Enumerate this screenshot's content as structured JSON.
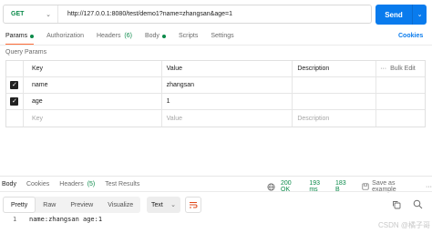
{
  "request": {
    "method": "GET",
    "url": "http://127.0.0.1:8080/test/demo1?name=zhangsan&age=1",
    "send_label": "Send"
  },
  "request_tabs": [
    {
      "label": "Params",
      "active": true,
      "dot": true
    },
    {
      "label": "Authorization"
    },
    {
      "label": "Headers",
      "count": "(6)"
    },
    {
      "label": "Body",
      "dot": true
    },
    {
      "label": "Scripts"
    },
    {
      "label": "Settings"
    }
  ],
  "cookies_label": "Cookies",
  "query_params": {
    "title": "Query Params",
    "headers": {
      "key": "Key",
      "value": "Value",
      "description": "Description",
      "bulk_edit": "Bulk Edit"
    },
    "rows": [
      {
        "checked": true,
        "key": "name",
        "value": "zhangsan",
        "description": ""
      },
      {
        "checked": true,
        "key": "age",
        "value": "1",
        "description": ""
      }
    ],
    "placeholder": {
      "key": "Key",
      "value": "Value",
      "description": "Description"
    }
  },
  "response_tabs": [
    {
      "label": "Body",
      "active": true
    },
    {
      "label": "Cookies"
    },
    {
      "label": "Headers",
      "count": "(5)"
    },
    {
      "label": "Test Results"
    }
  ],
  "response_status": {
    "status": "200 OK",
    "time": "193 ms",
    "size": "183 B",
    "save_label": "Save as example",
    "more": "···"
  },
  "view_modes": [
    "Pretty",
    "Raw",
    "Preview",
    "Visualize"
  ],
  "active_view": "Pretty",
  "format": "Text",
  "response_body": [
    {
      "line": "1",
      "text": "name:zhangsan age:1"
    }
  ],
  "watermark": "CSDN @橘子哥",
  "colors": {
    "accent": "#ff6c37",
    "send": "#097bed",
    "success": "#0b8a4a",
    "method": "#0b8a4a"
  }
}
